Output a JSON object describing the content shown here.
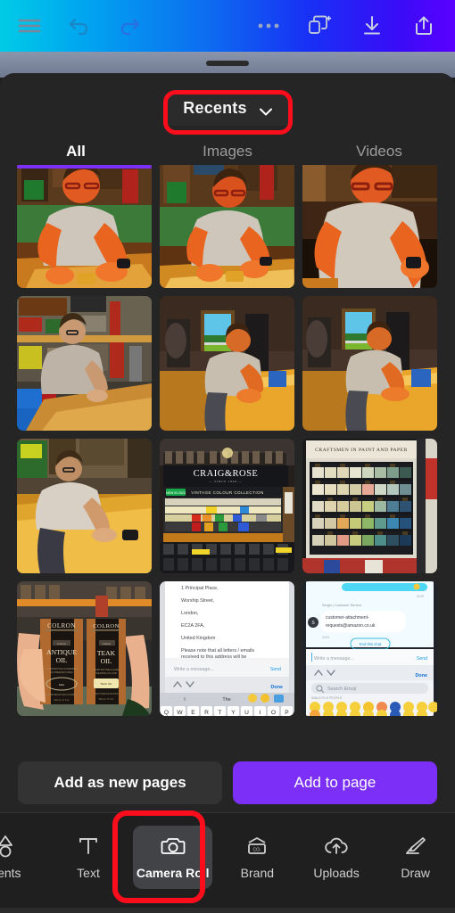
{
  "app": {
    "name": "Canva Mobile Editor",
    "theme_bg": "#1f1f1f",
    "accent": "#7b2ff7",
    "annotation_color": "#fc0d1b"
  },
  "toolbar": {
    "left_icons": [
      {
        "name": "hamburger-menu-icon",
        "label": "Menu"
      },
      {
        "name": "undo-icon",
        "label": "Undo"
      },
      {
        "name": "redo-icon",
        "label": "Redo"
      }
    ],
    "right_icons": [
      {
        "name": "more-options-icon",
        "label": "More"
      },
      {
        "name": "magic-shapes-icon",
        "label": "Magic Studio"
      },
      {
        "name": "download-icon",
        "label": "Download"
      },
      {
        "name": "share-icon",
        "label": "Share"
      }
    ]
  },
  "sheet": {
    "source_selector": {
      "label": "Recents",
      "chevron": "chevron-down-icon",
      "highlighted": true
    },
    "tabs": [
      {
        "label": "All",
        "active": true
      },
      {
        "label": "Images",
        "active": false
      },
      {
        "label": "Videos",
        "active": false
      }
    ]
  },
  "grid": {
    "rows": [
      [
        {
          "id": "p1",
          "alt": "Man in grey t-shirt sanding a wooden plank in a workshop, red lighting",
          "kind": "workshop-red-1"
        },
        {
          "id": "p2",
          "alt": "Man sanding a wooden plank on a bench, red lighting",
          "kind": "workshop-red-2"
        },
        {
          "id": "p3",
          "alt": "Close up of man leaning over bench wearing glasses, red lighting",
          "kind": "workshop-red-3"
        }
      ],
      [
        {
          "id": "p4",
          "alt": "Man measuring a wooden worktop in a cluttered garage",
          "kind": "garage-shelves"
        },
        {
          "id": "p5",
          "alt": "Man sanding a yellow wooden chest beside an open door to a green field",
          "kind": "door-field-1"
        },
        {
          "id": "p6",
          "alt": "Man sanding a yellow wooden chest beside an open door to a green field",
          "kind": "door-field-2"
        }
      ],
      [
        {
          "id": "p7",
          "alt": "Man wiping down a yellow wooden surface in workshop",
          "kind": "yellow-bench"
        },
        {
          "id": "p8",
          "alt": "Craig & Rose paint display stand in store",
          "kind": "craig-rose",
          "text": [
            "CRAIG & ROSE",
            "SINCE 1829",
            "VINTAGE COLOUR COLLECTION",
            "NEW IN"
          ]
        },
        {
          "id": "p9",
          "alt": "Shelves of paint tester pots under a Craftsmen in Paint and Paper sign",
          "kind": "paint-shelf",
          "text": [
            "CRAFTSMEN IN PAINT AND PAPER"
          ]
        }
      ],
      [
        {
          "id": "p10",
          "alt": "Hand holding two Colron oil tins in a shop",
          "kind": "colron-tins",
          "text": [
            "COLRON",
            "COLRON",
            "ANTIQUE OIL",
            "TEAK OIL"
          ]
        },
        {
          "id": "p11",
          "alt": "Phone screenshot of a chat showing a UK postal address with keyboard open",
          "kind": "chat-address",
          "text": [
            "1 Principal Place,",
            "Worship Street,",
            "London,",
            "EC2A 2FA,",
            "United Kingdom",
            "Please note that all letters / emails received to this address will be passed to Customer Service for",
            "Write a message...",
            "Send",
            "Done",
            "I",
            "The"
          ]
        },
        {
          "id": "p12",
          "alt": "Phone screenshot of an Amazon customer service chat with emoji keyboard",
          "kind": "chat-amazon",
          "text": [
            "Sergio | Customer Service",
            "customer-attachment-",
            "requests@amazon.co.uk",
            "20:09",
            "End this chat",
            "Write a message...",
            "Send",
            "Done",
            "Search Emoji",
            "SMILEYS & PEOPLE"
          ]
        }
      ]
    ]
  },
  "actions": {
    "add_as_new_pages": "Add as new pages",
    "add_to_page": "Add to page"
  },
  "bottom_nav": [
    {
      "label": "ents",
      "icon": "elements-icon",
      "selected": false,
      "clipped": true
    },
    {
      "label": "Text",
      "icon": "text-icon",
      "selected": false
    },
    {
      "label": "Camera Roll",
      "icon": "camera-icon",
      "selected": true
    },
    {
      "label": "Brand",
      "icon": "brand-icon",
      "selected": false
    },
    {
      "label": "Uploads",
      "icon": "upload-cloud-icon",
      "selected": false
    },
    {
      "label": "Draw",
      "icon": "draw-pen-icon",
      "selected": false
    }
  ]
}
